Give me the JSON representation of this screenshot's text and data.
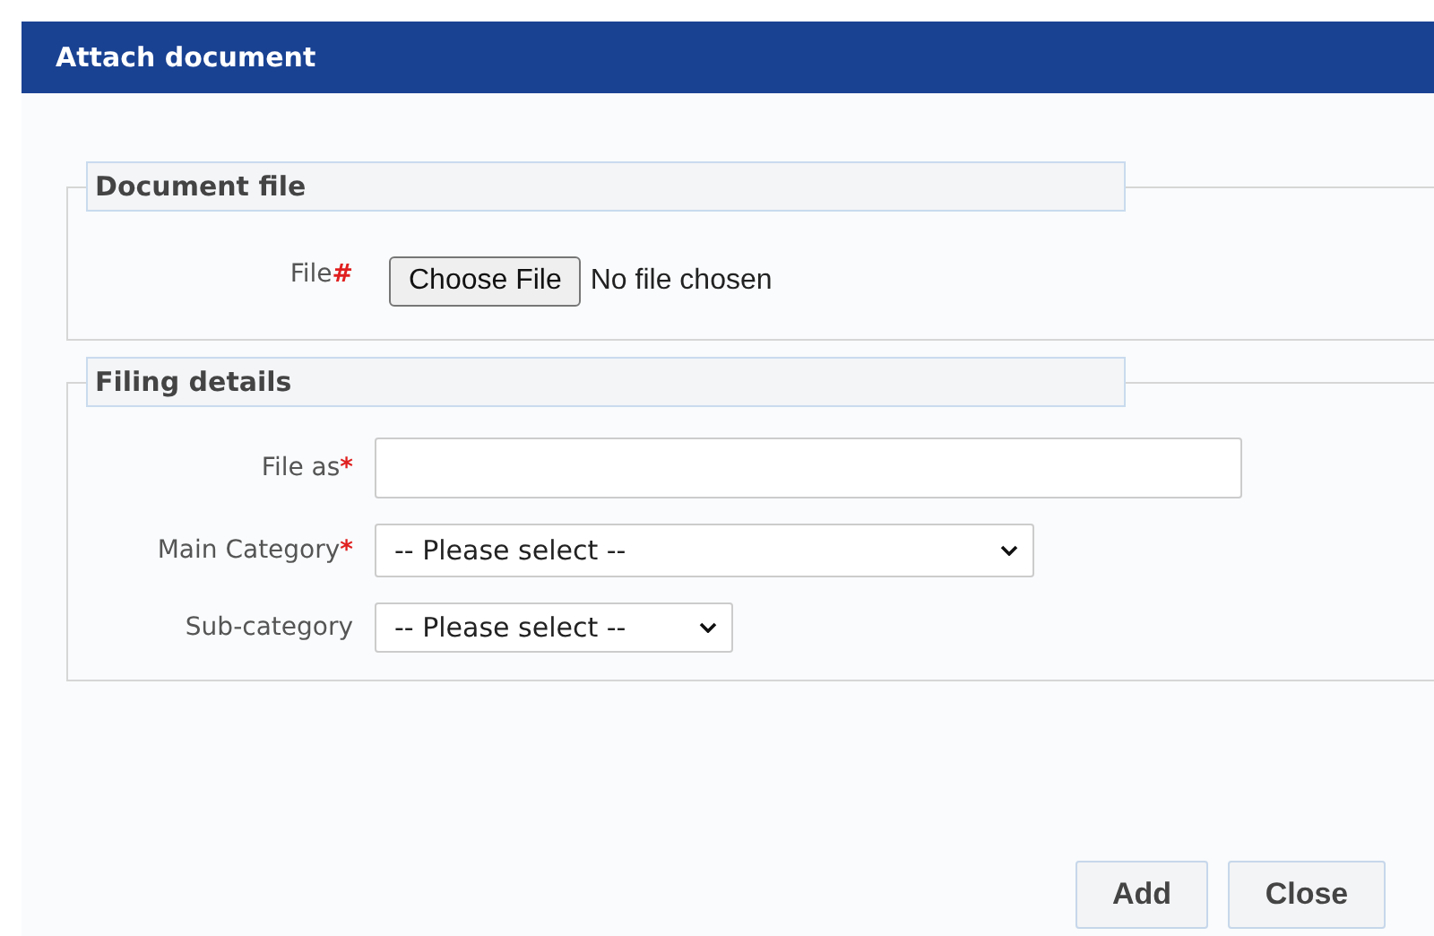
{
  "window": {
    "title": "Attach document"
  },
  "sections": [
    {
      "title": "Document file",
      "fields": [
        {
          "kind": "file",
          "label": "File",
          "marker": "#",
          "button": "Choose File",
          "status": "No file chosen"
        }
      ]
    },
    {
      "title": "Filing details",
      "fields": [
        {
          "kind": "text",
          "label": "File as",
          "marker": "*"
        },
        {
          "kind": "select",
          "label": "Main Category",
          "marker": "*",
          "value": "-- Please select --"
        },
        {
          "kind": "select",
          "label": "Sub-category",
          "value": "-- Please select --"
        }
      ]
    }
  ],
  "buttons": [
    "Add",
    "Close"
  ]
}
